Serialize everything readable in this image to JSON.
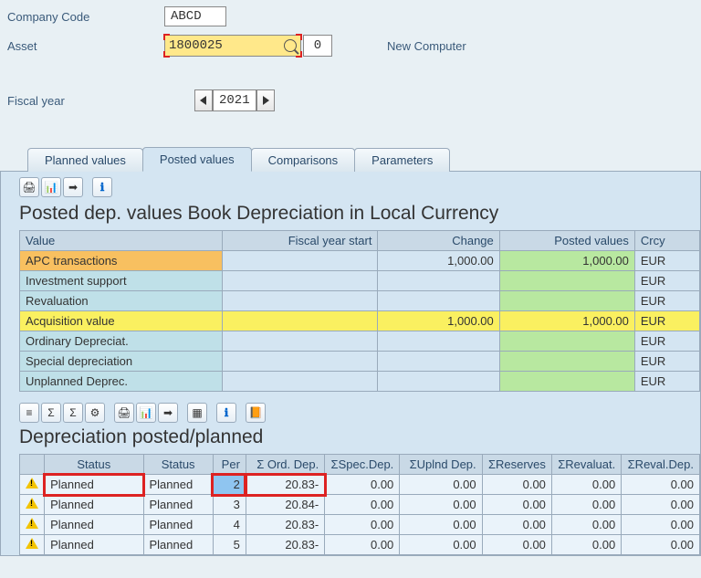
{
  "header": {
    "company_code_label": "Company Code",
    "company_code_value": "ABCD",
    "asset_label": "Asset",
    "asset_value": "1800025",
    "asset_subno": "0",
    "asset_desc": "New Computer",
    "fiscal_year_label": "Fiscal year",
    "fiscal_year_value": "2021"
  },
  "tabs": {
    "planned": "Planned values",
    "posted": "Posted values",
    "comparisons": "Comparisons",
    "parameters": "Parameters"
  },
  "posted_values": {
    "title": "Posted dep. values Book Depreciation in Local Currency",
    "columns": {
      "value": "Value",
      "fy_start": "Fiscal year start",
      "change": "Change",
      "posted": "Posted values",
      "crcy": "Crcy"
    },
    "rows": [
      {
        "label": "APC transactions",
        "fy_start": "",
        "change": "1,000.00",
        "posted": "1,000.00",
        "crcy": "EUR",
        "label_style": "orange",
        "posted_green": true
      },
      {
        "label": "Investment support",
        "fy_start": "",
        "change": "",
        "posted": "",
        "crcy": "EUR",
        "label_style": "blue",
        "posted_green": true
      },
      {
        "label": "Revaluation",
        "fy_start": "",
        "change": "",
        "posted": "",
        "crcy": "EUR",
        "label_style": "blue",
        "posted_green": true
      },
      {
        "label": "Acquisition value",
        "fy_start": "",
        "change": "1,000.00",
        "posted": "1,000.00",
        "crcy": "EUR",
        "label_style": "yellow_row"
      },
      {
        "label": "Ordinary Depreciat.",
        "fy_start": "",
        "change": "",
        "posted": "",
        "crcy": "EUR",
        "label_style": "blue",
        "posted_green": true
      },
      {
        "label": "Special depreciation",
        "fy_start": "",
        "change": "",
        "posted": "",
        "crcy": "EUR",
        "label_style": "blue",
        "posted_green": true
      },
      {
        "label": "Unplanned Deprec.",
        "fy_start": "",
        "change": "",
        "posted": "",
        "crcy": "EUR",
        "label_style": "blue",
        "posted_green": true
      }
    ]
  },
  "dep_plan": {
    "title": "Depreciation posted/planned",
    "columns": {
      "status1": "Status",
      "status2": "Status",
      "per": "Per",
      "ord": "Σ Ord. Dep.",
      "spec": "ΣSpec.Dep.",
      "upl": "ΣUplnd Dep.",
      "res": "ΣReserves",
      "reval": "ΣRevaluat.",
      "revdep": "ΣReval.Dep."
    },
    "rows": [
      {
        "status1": "Planned",
        "status2": "Planned",
        "per": "2",
        "ord": "20.83-",
        "spec": "0.00",
        "upl": "0.00",
        "res": "0.00",
        "reval": "0.00",
        "revdep": "0.00",
        "highlight": true
      },
      {
        "status1": "Planned",
        "status2": "Planned",
        "per": "3",
        "ord": "20.84-",
        "spec": "0.00",
        "upl": "0.00",
        "res": "0.00",
        "reval": "0.00",
        "revdep": "0.00"
      },
      {
        "status1": "Planned",
        "status2": "Planned",
        "per": "4",
        "ord": "20.83-",
        "spec": "0.00",
        "upl": "0.00",
        "res": "0.00",
        "reval": "0.00",
        "revdep": "0.00"
      },
      {
        "status1": "Planned",
        "status2": "Planned",
        "per": "5",
        "ord": "20.83-",
        "spec": "0.00",
        "upl": "0.00",
        "res": "0.00",
        "reval": "0.00",
        "revdep": "0.00"
      }
    ]
  },
  "icons": {
    "print": "🖨",
    "export": "📊",
    "toexcel": "➡",
    "info": "ℹ",
    "sort": "≡",
    "sum": "Σ",
    "filter": "⚙",
    "chart": "📈",
    "layout": "▦",
    "find": "🔍",
    "orange": "📙"
  }
}
